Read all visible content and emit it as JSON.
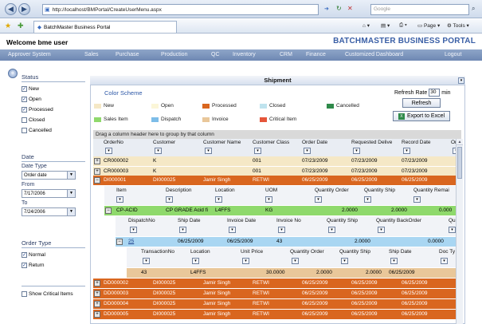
{
  "browser": {
    "url": "http://localhost/BMPortal/CreateUserMenu.aspx",
    "search_placeholder": "Google",
    "tab_title": "BatchMaster Business Portal",
    "cmd_page": "Page",
    "cmd_tools": "Tools"
  },
  "header": {
    "welcome": "Welcome bme user",
    "brand": "BATCHMASTER BUSINESS PORTAL"
  },
  "nav": [
    "Approver System",
    "Sales",
    "Purchase",
    "Production",
    "QC",
    "Inventory",
    "CRM",
    "Finance",
    "Customized Dashboard",
    "Logout"
  ],
  "sidebar": {
    "status_title": "Status",
    "status": [
      {
        "label": "New",
        "checked": true
      },
      {
        "label": "Open",
        "checked": true
      },
      {
        "label": "Processed",
        "checked": true
      },
      {
        "label": "Closed",
        "checked": false
      },
      {
        "label": "Cancelled",
        "checked": false
      }
    ],
    "date_title": "Date",
    "date_type_label": "Date Type",
    "date_type_value": "Order date",
    "from_label": "From",
    "from_value": "7/17/2006",
    "to_label": "To",
    "to_value": "7/24/2006",
    "order_type_title": "Order Type",
    "order_types": [
      {
        "label": "Normal",
        "checked": true
      },
      {
        "label": "Return",
        "checked": true
      }
    ],
    "show_critical": "Show Critical Items"
  },
  "panel": {
    "title": "Shipment",
    "color_scheme_title": "Color Scheme",
    "legend": [
      {
        "label": "New",
        "color": "#f5e8c6"
      },
      {
        "label": "Open",
        "color": "#fbf6d8"
      },
      {
        "label": "Processed",
        "color": "#d9661f"
      },
      {
        "label": "Closed",
        "color": "#bfe3ee"
      },
      {
        "label": "Cancelled",
        "color": "#2f8a4a"
      },
      {
        "label": "Sales Item",
        "color": "#8fd96c"
      },
      {
        "label": "Dispatch",
        "color": "#7dbde8"
      },
      {
        "label": "Invoice",
        "color": "#e9c79a"
      },
      {
        "label": "Critical Item",
        "color": "#e5553a"
      }
    ],
    "refresh_rate_label": "Refresh Rate",
    "refresh_rate_value": "30",
    "refresh_unit": "min",
    "refresh_button": "Refresh",
    "export_button": "Export to Excel",
    "group_hint": "Drag a column header here to group by that column"
  },
  "grid": {
    "columns": [
      "OrderNo",
      "Customer",
      "Customer Name",
      "Customer Class",
      "Order Date",
      "Requested Delive",
      "Record Date",
      "Orde"
    ],
    "rows": [
      {
        "order": "CR000002",
        "customer": "K",
        "name": "",
        "cls": "001",
        "odate": "07/23/2009",
        "rdate": "07/23/2009",
        "rec": "07/23/2009",
        "status": "new"
      },
      {
        "order": "CR000003",
        "customer": "K",
        "name": "",
        "cls": "001",
        "odate": "07/23/2009",
        "rdate": "07/23/2009",
        "rec": "07/23/2009",
        "status": "new"
      },
      {
        "order": "DI000001",
        "customer": "DI000025",
        "name": "Jamir Singh",
        "cls": "RETWI",
        "odate": "06/25/2009",
        "rdate": "06/25/2009",
        "rec": "06/25/2009",
        "status": "processed"
      }
    ],
    "item_columns": [
      "Item",
      "Description",
      "Location",
      "UOM",
      "Quantity Order",
      "Quantity Ship",
      "Quantity Remai"
    ],
    "item_row": {
      "item": "CP-ACID",
      "desc": "CP GRADE Acid fi",
      "loc": "L4FFS",
      "uom": "KG",
      "qorder": "2.0000",
      "qship": "2.0000",
      "qrem": "0.000"
    },
    "dispatch_columns": [
      "DispatchNo",
      "Ship Date",
      "Invoice Date",
      "Invoice No",
      "Quantity Ship",
      "Quantity BackOrder",
      "Qu"
    ],
    "dispatch_row": {
      "no": "25",
      "ship": "06/25/2009",
      "inv_date": "06/25/2009",
      "inv_no": "43",
      "qship": "2.0000",
      "qback": "0.0000"
    },
    "txn_columns": [
      "TransactionNo",
      "Location",
      "Unit Price",
      "Quantity Order",
      "Quantity Ship",
      "Ship Date",
      "Doc Ty"
    ],
    "txn_row": {
      "no": "43",
      "loc": "L4FFS",
      "price": "30.0000",
      "qorder": "2.0000",
      "qship": "2.0000",
      "date": "06/25/2009"
    },
    "more_rows": [
      {
        "order": "DD000002",
        "customer": "DI000025",
        "name": "Jamir Singh",
        "cls": "RETWI",
        "odate": "06/25/2009",
        "rdate": "06/25/2009",
        "rec": "06/25/2009"
      },
      {
        "order": "DD000003",
        "customer": "DI000025",
        "name": "Jamir Singh",
        "cls": "RETWI",
        "odate": "06/25/2009",
        "rdate": "06/25/2009",
        "rec": "06/25/2009"
      },
      {
        "order": "DD000004",
        "customer": "DI000025",
        "name": "Jamir Singh",
        "cls": "RETWI",
        "odate": "06/25/2009",
        "rdate": "06/25/2009",
        "rec": "06/25/2009"
      },
      {
        "order": "DD000005",
        "customer": "DI000025",
        "name": "Jamir Singh",
        "cls": "RETWI",
        "odate": "06/25/2009",
        "rdate": "06/25/2009",
        "rec": "06/25/2009"
      }
    ]
  }
}
